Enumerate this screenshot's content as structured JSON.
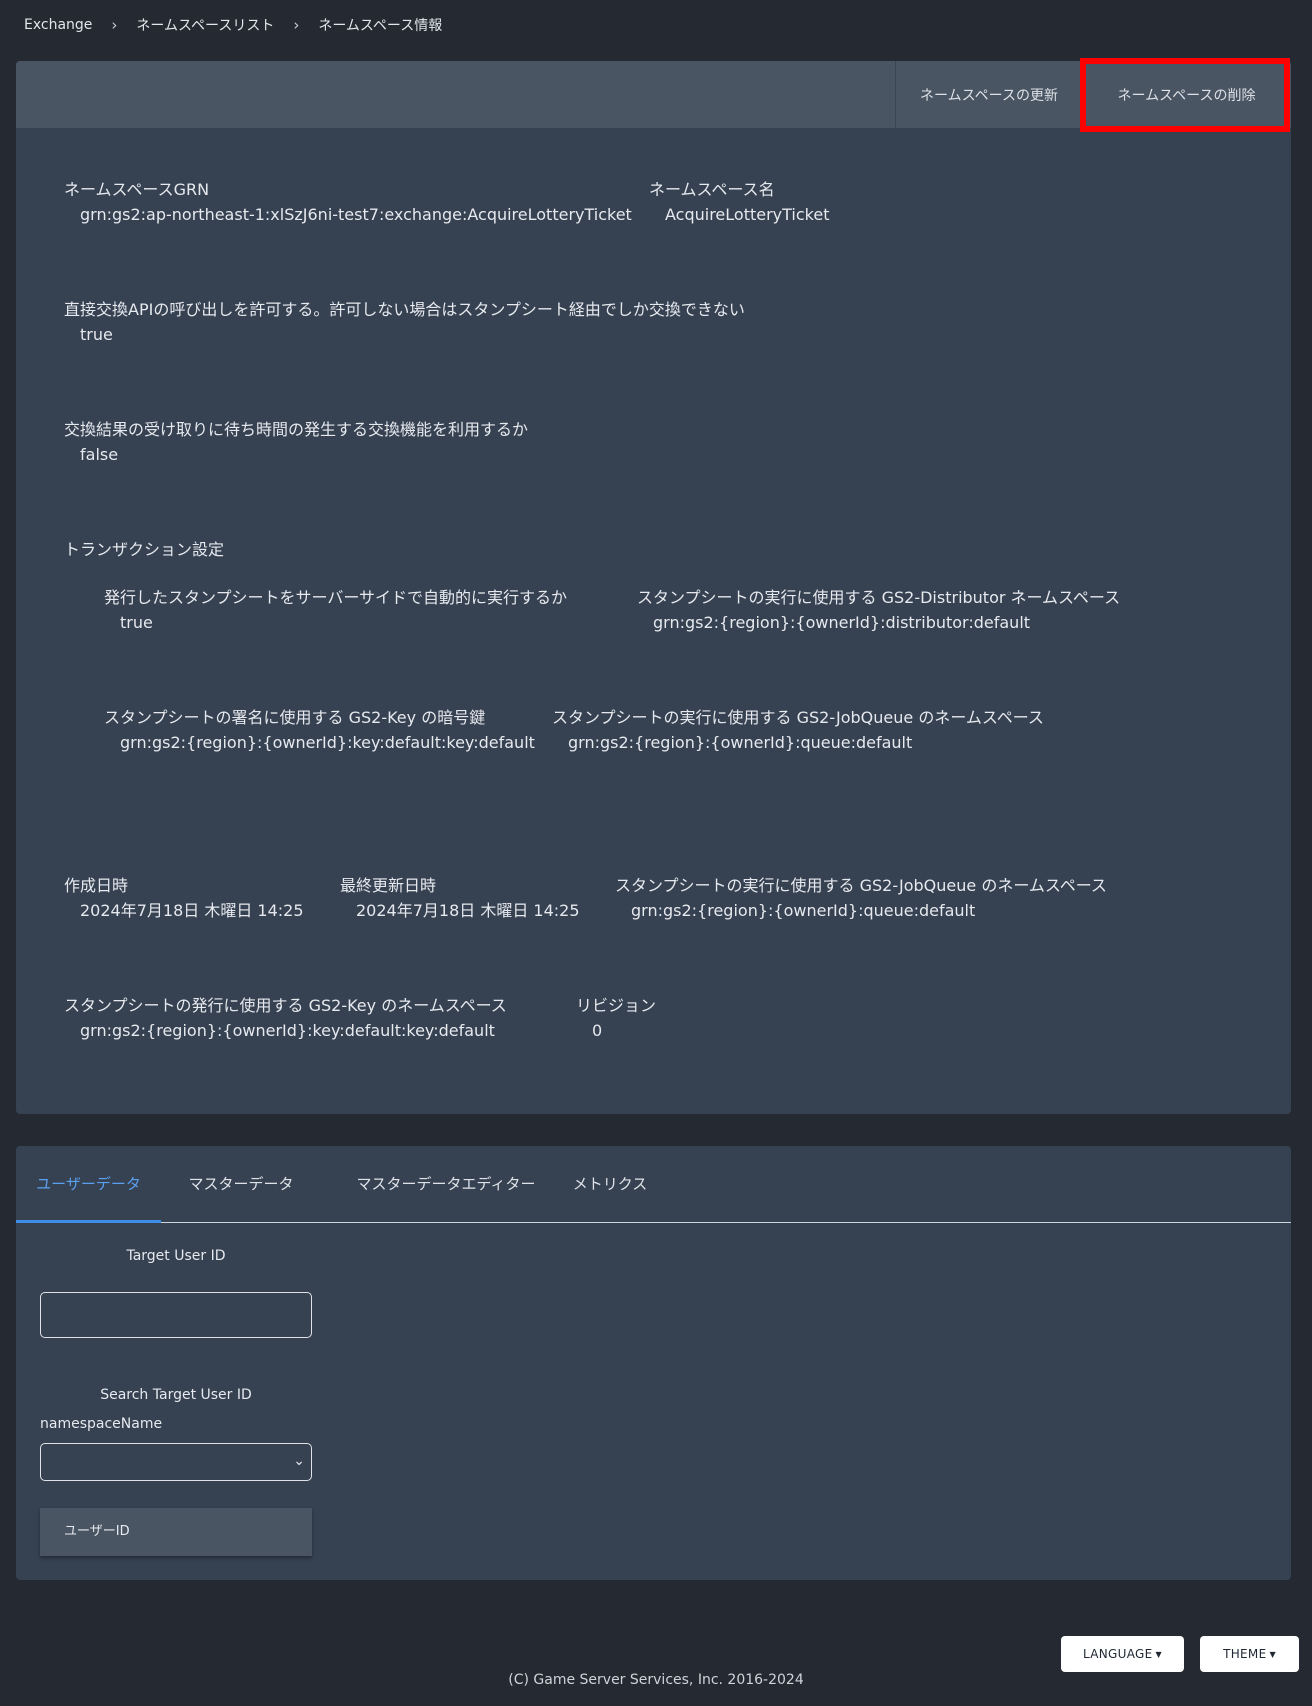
{
  "breadcrumb": {
    "items": [
      "Exchange",
      "ネームスペースリスト",
      "ネームスペース情報"
    ],
    "separator": "›"
  },
  "header": {
    "update_label": "ネームスペースの更新",
    "delete_label": "ネームスペースの削除"
  },
  "namespace": {
    "grn_label": "ネームスペースGRN",
    "grn_value": "grn:gs2:ap-northeast-1:xlSzJ6ni-test7:exchange:AcquireLotteryTicket",
    "name_label": "ネームスペース名",
    "name_value": "AcquireLotteryTicket",
    "direct_exchange_label": "直接交換APIの呼び出しを許可する。許可しない場合はスタンプシート経由でしか交換できない",
    "direct_exchange_value": "true",
    "await_exchange_label": "交換結果の受け取りに待ち時間の発生する交換機能を利用するか",
    "await_exchange_value": "false",
    "transaction_label": "トランザクション設定",
    "auto_run_label": "発行したスタンプシートをサーバーサイドで自動的に実行するか",
    "auto_run_value": "true",
    "distributor_label": "スタンプシートの実行に使用する GS2-Distributor ネームスペース",
    "distributor_value": "grn:gs2:{region}:{ownerId}:distributor:default",
    "key_label": "スタンプシートの署名に使用する GS2-Key の暗号鍵",
    "key_value": "grn:gs2:{region}:{ownerId}:key:default:key:default",
    "jobqueue_label": "スタンプシートの実行に使用する GS2-JobQueue のネームスペース",
    "jobqueue_value": "grn:gs2:{region}:{ownerId}:queue:default",
    "created_label": "作成日時",
    "created_value": "2024年7月18日 木曜日 14:25",
    "updated_label": "最終更新日時",
    "updated_value": "2024年7月18日 木曜日 14:25",
    "jobqueue2_label": "スタンプシートの実行に使用する GS2-JobQueue のネームスペース",
    "jobqueue2_value": "grn:gs2:{region}:{ownerId}:queue:default",
    "issue_key_label": "スタンプシートの発行に使用する GS2-Key のネームスペース",
    "issue_key_value": "grn:gs2:{region}:{ownerId}:key:default:key:default",
    "revision_label": "リビジョン",
    "revision_value": "0"
  },
  "tabs": [
    {
      "label": "ユーザーデータ",
      "active": true
    },
    {
      "label": "マスターデータ",
      "active": false
    },
    {
      "label": "マスターデータエディター",
      "active": false
    },
    {
      "label": "メトリクス",
      "active": false
    }
  ],
  "user_search": {
    "target_label": "Target User ID",
    "target_value": "",
    "search_label": "Search Target User ID",
    "namespace_label": "namespaceName",
    "namespace_selected": "",
    "column_user_id": "ユーザーID"
  },
  "footer": {
    "language_label": "LANGUAGE",
    "theme_label": "THEME",
    "copyright": "(C) Game Server Services, Inc. 2016-2024"
  },
  "colors": {
    "background": "#242932",
    "card": "#364151",
    "card_header": "#4a5563",
    "active_tab": "#5aa0f0",
    "highlight": "#ff0000"
  },
  "icons": {
    "breadcrumb_separator": "chevron-right-icon",
    "select_arrow": "chevron-down-icon",
    "dropdown_caret": "caret-down-icon"
  }
}
